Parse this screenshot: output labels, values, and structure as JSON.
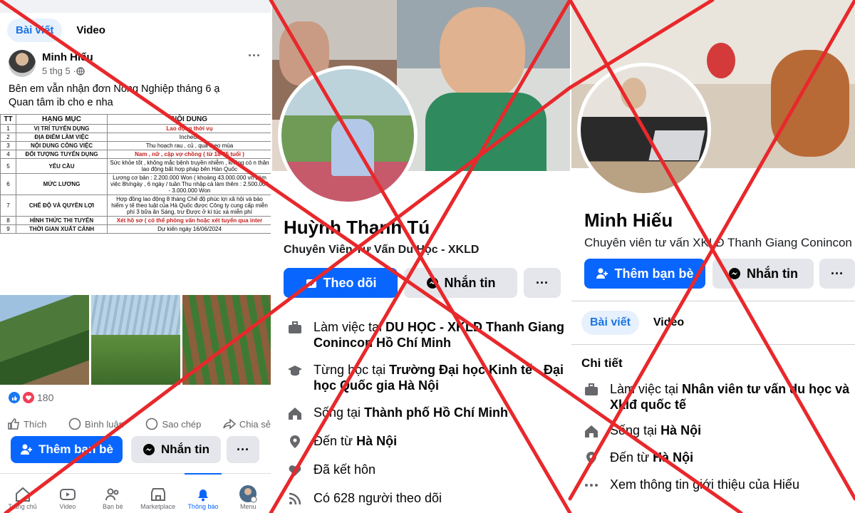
{
  "panel1": {
    "tabs": [
      "Bài viết",
      "Video"
    ],
    "post": {
      "author": "Minh Hiếu",
      "time": "5 thg 5 · ",
      "more": "···",
      "line1": "Bên em vẫn nhận đơn Nông Nghiệp tháng 6 ạ",
      "line2": "Quan tâm ib cho e nha"
    },
    "table": {
      "headers": [
        "TT",
        "HẠNG MỤC",
        "NỘI DUNG"
      ],
      "rows": [
        [
          "1",
          "VỊ TRÍ TUYỂN DỤNG",
          "Lao động thời vụ"
        ],
        [
          "2",
          "ĐỊA ĐIỂM LÀM VIỆC",
          "Incheon"
        ],
        [
          "3",
          "NỘI DUNG CÔNG VIỆC",
          "Thu hoạch rau , củ , quả theo mùa"
        ],
        [
          "4",
          "ĐỐI TƯỢNG TUYỂN DỤNG",
          "Nam , nữ , cặp vợ chồng ( từ 18-55 tuổi )"
        ],
        [
          "5",
          "YÊU CẦU",
          "Sức khỏe tốt , không mắc bệnh truyền nhiễm , không có n thân lao động bất hợp pháp bên Hàn Quốc"
        ],
        [
          "6",
          "MỨC LƯƠNG",
          "Lương cơ bản : 2.200.000 Won ( khoảng 43.000.000 vn Làm việc 8h/ngày , 6 ngày / tuần Thu nhập cả làm thêm : 2.500.000 - 3.000.000 Won"
        ],
        [
          "7",
          "CHẾ ĐỘ VÀ QUYỀN LỢI",
          "Hợp đồng lao động 8 tháng Chế độ phúc lợi xã hội và bảo hiểm y tế theo luật của Hà Quốc được Công ty cung cấp miễn phí 3 bữa ăn Sáng, trư Được ở kí túc xá miễn phí"
        ],
        [
          "8",
          "HÌNH THỨC THI TUYỂN",
          "Xét hồ sơ ( có thể phỏng vấn hoặc xét tuyển qua inter"
        ],
        [
          "9",
          "THỜI GIAN XUẤT CẢNH",
          "Dự kiến ngày 16/06/2024"
        ]
      ]
    },
    "reactions": "180",
    "actions": [
      "Thích",
      "Bình luận",
      "Sao chép",
      "Chia sẻ"
    ],
    "add_friend": "Thêm bạn bè",
    "message": "Nhắn tin",
    "more_btn": "···",
    "nav": [
      "Trang chủ",
      "Video",
      "Bạn bè",
      "Marketplace",
      "Thông báo",
      "Menu"
    ]
  },
  "panel2": {
    "name": "Huỳnh Thanh Tú",
    "subtitle": "Chuyên Viên Tư Vấn Du Học - XKLD",
    "follow": "Theo dõi",
    "message": "Nhắn tin",
    "more_btn": "···",
    "info": [
      {
        "icon": "briefcase-icon",
        "pre": "Làm việc tại ",
        "bold": "DU HỌC - XKLĐ Thanh Giang Conincon Hồ Chí Minh"
      },
      {
        "icon": "graduation-cap-icon",
        "pre": "Từng học tại ",
        "bold": "Trường Đại học Kinh tế - Đại học Quốc gia Hà Nội"
      },
      {
        "icon": "home-icon",
        "pre": "Sống tại ",
        "bold": "Thành phố Hồ Chí Minh"
      },
      {
        "icon": "location-pin-icon",
        "pre": "Đến từ ",
        "bold": "Hà Nội"
      },
      {
        "icon": "heart-icon",
        "pre": "Đã kết hôn",
        "bold": ""
      },
      {
        "icon": "rss-icon",
        "pre": "Có 628 người theo dõi",
        "bold": ""
      }
    ]
  },
  "panel3": {
    "name": "Minh Hiếu",
    "subtitle": "Chuyên viên tư vấn XKLĐ Thanh Giang Conincon",
    "add_friend": "Thêm bạn bè",
    "message": "Nhắn tin",
    "more_btn": "···",
    "tabs": [
      "Bài viết",
      "Video"
    ],
    "details_title": "Chi tiết",
    "info": [
      {
        "icon": "briefcase-icon",
        "pre": "Làm việc tại ",
        "bold": "Nhân viên tư vấn du học và Xklđ quốc tế"
      },
      {
        "icon": "home-icon",
        "pre": "Sống tại ",
        "bold": "Hà Nội"
      },
      {
        "icon": "location-pin-icon",
        "pre": "Đến từ ",
        "bold": "Hà Nội"
      },
      {
        "icon": "ellipsis-icon",
        "pre": "Xem thông tin giới thiệu của Hiếu",
        "bold": ""
      }
    ]
  },
  "colors": {
    "accent": "#0866ff",
    "cross": "#e8282b",
    "tab_bg": "#e7f0fd"
  }
}
